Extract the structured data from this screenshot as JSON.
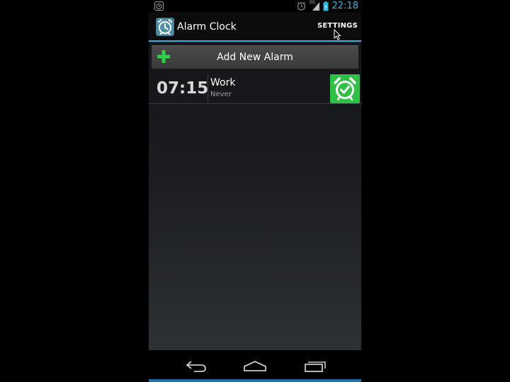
{
  "status_bar": {
    "time": "22:18",
    "network_label": "3G"
  },
  "action_bar": {
    "title": "Alarm Clock",
    "settings_label": "SETTINGS"
  },
  "add_alarm": {
    "label": "Add New Alarm"
  },
  "alarms": [
    {
      "time": "07:15",
      "label": "Work",
      "repeat": "Never",
      "enabled": true
    }
  ],
  "colors": {
    "accent": "#33b5e5",
    "toggle_on": "#2fc145",
    "plus": "#2fd04a"
  },
  "icons": {
    "app": "alarm-clock-icon",
    "add": "plus-icon",
    "toggle": "alarm-clock-icon",
    "nav": [
      "back-icon",
      "home-icon",
      "recent-apps-icon"
    ]
  }
}
